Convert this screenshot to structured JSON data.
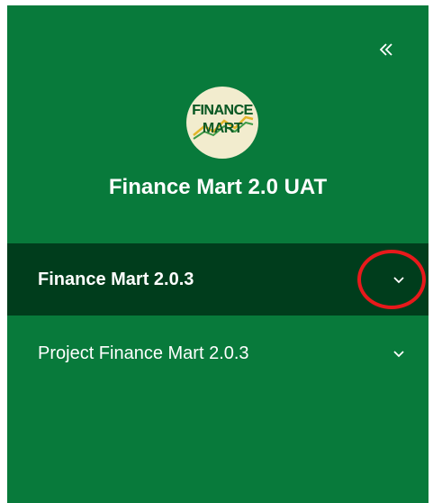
{
  "sidebar": {
    "collapse_icon": "double-chevron-left-icon",
    "logo": {
      "line1": "FINANCE",
      "line2": "MART"
    },
    "app_title": "Finance Mart 2.0 UAT",
    "items": [
      {
        "label": "Finance Mart 2.0.3",
        "active": true,
        "icon": "chevron-down-icon"
      },
      {
        "label": "Project Finance Mart 2.0.3",
        "active": false,
        "icon": "chevron-down-icon"
      }
    ]
  },
  "colors": {
    "sidebar_bg": "#087a3b",
    "active_item_bg": "#003d1c",
    "logo_bg": "#f2ecce",
    "highlight_ring": "#e8191b"
  }
}
